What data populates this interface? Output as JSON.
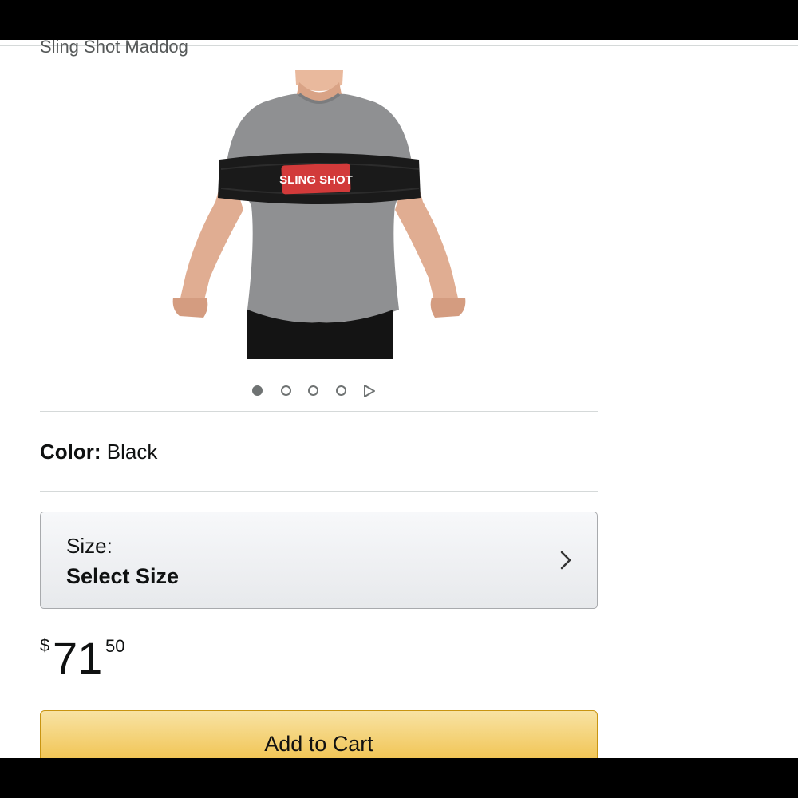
{
  "product": {
    "brand": "Sling Shot Maddog",
    "image_label": "SLING SHOT",
    "carousel": {
      "count": 4,
      "active_index": 0
    }
  },
  "color": {
    "label": "Color:",
    "value": "Black"
  },
  "size": {
    "label": "Size:",
    "value": "Select Size"
  },
  "price": {
    "currency": "$",
    "whole": "71",
    "fraction": "50"
  },
  "cart": {
    "label": "Add to Cart"
  },
  "colors": {
    "button_top": "#f8e3a4",
    "button_bottom": "#f0c14b",
    "divider": "#d5d9d9"
  },
  "icons": {
    "next": "play-triangle-icon",
    "chevron": "chevron-right-icon"
  }
}
